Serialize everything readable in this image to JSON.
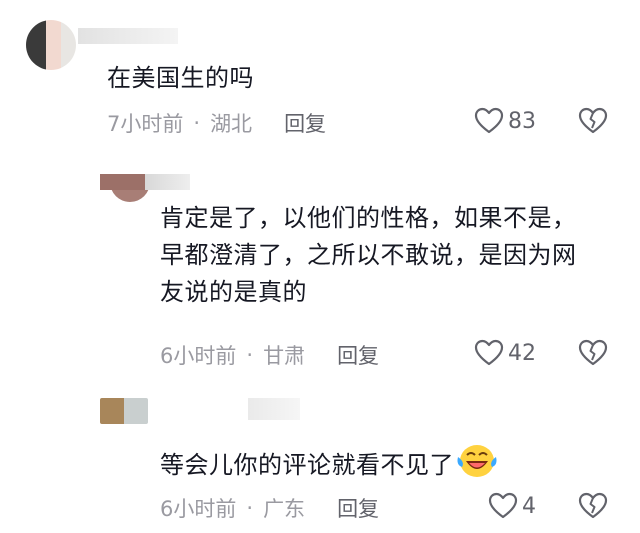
{
  "comments": [
    {
      "text": "在美国生的吗",
      "time": "7小时前",
      "location": "湖北",
      "reply_label": "回复",
      "likes": "83"
    },
    {
      "text_lines": [
        "肯定是了，以他们的性格，如果不是，",
        "早都澄清了，之所以不敢说，是因为网",
        "友说的是真的"
      ],
      "time": "6小时前",
      "location": "甘肃",
      "reply_label": "回复",
      "likes": "42"
    },
    {
      "text": "等会儿你的评论就看不见了",
      "emoji": "laughing-crying-emoji",
      "time": "6小时前",
      "location": "广东",
      "reply_label": "回复",
      "likes": "4"
    }
  ],
  "separator": "·",
  "icons": {
    "like": "heart-outline-icon",
    "dislike": "broken-heart-icon"
  },
  "colors": {
    "text": "#161823",
    "meta": "#9a9aa1",
    "action": "#62636b"
  }
}
